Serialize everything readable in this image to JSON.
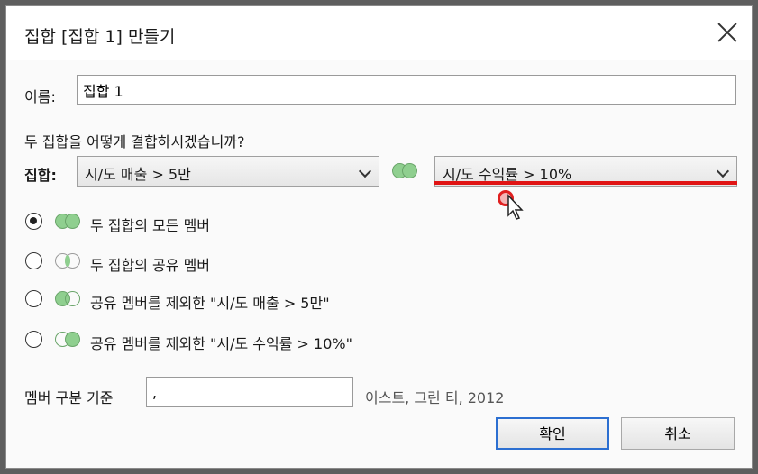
{
  "dialog": {
    "title": "집합 [집합 1] 만들기"
  },
  "name_row": {
    "label": "이름:",
    "value": "집합 1"
  },
  "question": "두 집합을 어떻게 결합하시겠습니까?",
  "sets_row": {
    "label": "집합:",
    "left_set": "시/도 매출 > 5만",
    "right_set": "시/도 수익률 > 10%"
  },
  "options": [
    {
      "label": "두 집합의 모든 멤버",
      "selected": true,
      "icon": "venn-union-icon"
    },
    {
      "label": "두 집합의 공유 멤버",
      "selected": false,
      "icon": "venn-intersection-icon"
    },
    {
      "label": "공유 멤버를 제외한 \"시/도 매출 > 5만\"",
      "selected": false,
      "icon": "venn-left-only-icon"
    },
    {
      "label": "공유 멤버를 제외한 \"시/도 수익률 > 10%\"",
      "selected": false,
      "icon": "venn-right-only-icon"
    }
  ],
  "separator_row": {
    "label": "멤버 구분 기준",
    "value": ",",
    "example": "이스트, 그린 티, 2012"
  },
  "buttons": {
    "ok": "확인",
    "cancel": "취소"
  },
  "colors": {
    "venn_fill": "#8fcf8f",
    "highlight_underline": "#e01414",
    "primary_border": "#2c6fd1"
  }
}
